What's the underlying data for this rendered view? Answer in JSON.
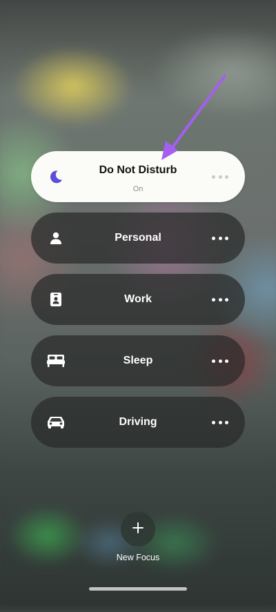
{
  "focus_modes": [
    {
      "label": "Do Not Disturb",
      "status": "On",
      "icon": "moon-icon",
      "active": true
    },
    {
      "label": "Personal",
      "icon": "person-icon",
      "active": false
    },
    {
      "label": "Work",
      "icon": "id-badge-icon",
      "active": false
    },
    {
      "label": "Sleep",
      "icon": "bed-icon",
      "active": false
    },
    {
      "label": "Driving",
      "icon": "car-icon",
      "active": false
    }
  ],
  "new_focus": {
    "label": "New Focus",
    "icon": "plus-icon"
  },
  "colors": {
    "active_background": "#fbfbf7",
    "inactive_background": "#2a2c2b",
    "moon_accent": "#5b4fd8",
    "annotation_arrow": "#a55ff0"
  }
}
